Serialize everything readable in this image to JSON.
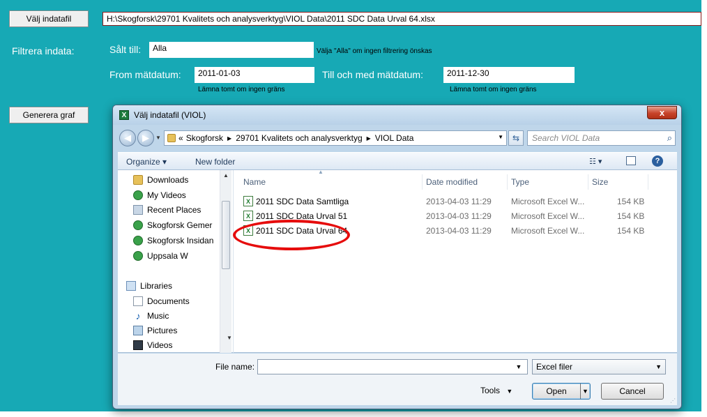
{
  "sheet": {
    "select_file_button": "Välj indatafil",
    "file_path": "H:\\Skogforsk\\29701 Kvalitets och analysverktyg\\VIOL Data\\2011 SDC Data Urval 64.xlsx",
    "filter_label": "Filtrera indata:",
    "sold_to_label": "Sålt till:",
    "sold_to_value": "Alla",
    "sold_to_hint": "Välja \"Alla\" om ingen filtrering önskas",
    "from_label": "From mätdatum:",
    "from_value": "2011-01-03",
    "to_label": "Till och med mätdatum:",
    "to_value": "2011-12-30",
    "empty_hint": "Lämna tomt om ingen gräns",
    "generate_button": "Generera graf"
  },
  "dialog": {
    "title": "Välj indatafil (VIOL)",
    "close": "x",
    "breadcrumb": {
      "prefix": "«",
      "parts": [
        "Skogforsk",
        "29701 Kvalitets och analysverktyg",
        "VIOL Data"
      ]
    },
    "search_placeholder": "Search VIOL Data",
    "toolbar": {
      "organize": "Organize ▾",
      "new_folder": "New folder"
    },
    "nav": {
      "items": [
        "Downloads",
        "My Videos",
        "Recent Places",
        "Skogforsk Gemer",
        "Skogforsk Insidan",
        "Uppsala W"
      ],
      "libraries": "Libraries",
      "library_items": [
        "Documents",
        "Music",
        "Pictures",
        "Videos"
      ]
    },
    "columns": {
      "name": "Name",
      "date": "Date modified",
      "type": "Type",
      "size": "Size"
    },
    "files": [
      {
        "name": "2011 SDC Data Samtliga",
        "date": "2013-04-03 11:29",
        "type": "Microsoft Excel W...",
        "size": "154 KB"
      },
      {
        "name": "2011 SDC Data Urval 51",
        "date": "2013-04-03 11:29",
        "type": "Microsoft Excel W...",
        "size": "154 KB"
      },
      {
        "name": "2011 SDC Data Urval 64",
        "date": "2013-04-03 11:29",
        "type": "Microsoft Excel W...",
        "size": "154 KB"
      }
    ],
    "footer": {
      "file_name_label": "File name:",
      "file_name_value": "",
      "filter": "Excel filer",
      "tools": "Tools",
      "open": "Open",
      "cancel": "Cancel"
    }
  },
  "colors": {
    "sheet_background": "#17a9b5",
    "highlight": "#e60c0c"
  }
}
